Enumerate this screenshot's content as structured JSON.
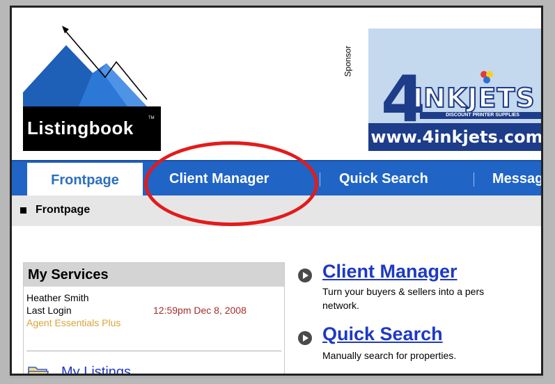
{
  "logo": {
    "name": "Listingbook",
    "tm": "TM"
  },
  "sponsor": {
    "label": "Sponsor",
    "ad_brand": "INKJETS",
    "ad_number": "4",
    "ad_tagline": "DISCOUNT PRINTER SUPPLIES",
    "ad_url": "www.4inkjets.com"
  },
  "nav": {
    "tabs": [
      {
        "label": "Frontpage",
        "active": true
      },
      {
        "label": "Client Manager",
        "active": false
      },
      {
        "label": "Quick Search",
        "active": false
      },
      {
        "label": "Messag",
        "active": false
      }
    ]
  },
  "breadcrumb": {
    "current": "Frontpage"
  },
  "services": {
    "title": "My Services",
    "user": "Heather Smith",
    "last_login_label": "Last Login",
    "last_login_value": "12:59pm Dec 8, 2008",
    "plan": "Agent Essentials Plus",
    "my_listings": "My Listings"
  },
  "features": [
    {
      "title": "Client Manager",
      "desc_line1": "Turn your buyers & sellers into a pers",
      "desc_line2": "network."
    },
    {
      "title": "Quick Search",
      "desc_line1": "Manually search for properties.",
      "desc_line2": ""
    }
  ],
  "colors": {
    "nav_bg": "#2064c6",
    "link": "#1d39c4",
    "highlight": "#e31b1b",
    "login_time": "#a62b2b",
    "plan": "#d9a33a"
  }
}
